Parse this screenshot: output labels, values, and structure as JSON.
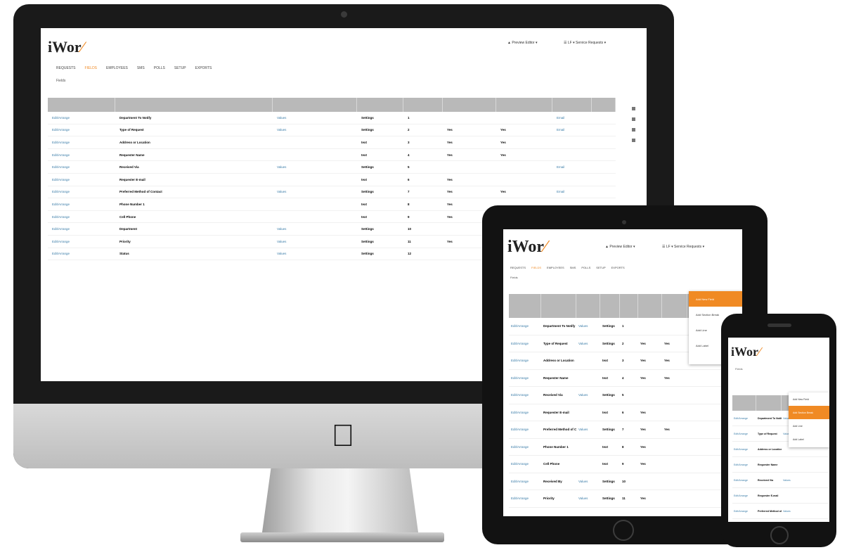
{
  "app": {
    "logo": "iWor",
    "user_label": "▲ Preview Editor ▾",
    "service_label": "☰ LF ▾  Service Requests ▾"
  },
  "tabs": [
    {
      "label": "REQUESTS"
    },
    {
      "label": "FIELDS",
      "active": true
    },
    {
      "label": "EMPLOYEES"
    },
    {
      "label": "SMS"
    },
    {
      "label": "POLLS"
    },
    {
      "label": "SETUP"
    },
    {
      "label": "EXPORTS"
    }
  ],
  "breadcrumb": "Fields",
  "imac_table": {
    "rows": [
      {
        "action": "Edit/Arrange",
        "name": "Department To Notify",
        "opt": "Values",
        "type": "Settings",
        "order": "1",
        "req": "",
        "shown": "",
        "flag": "Email"
      },
      {
        "action": "Edit/Arrange",
        "name": "Type of Request",
        "opt": "Values",
        "type": "Settings",
        "order": "2",
        "req": "Yes",
        "shown": "Yes",
        "flag": "Email"
      },
      {
        "action": "Edit/Arrange",
        "name": "Address or Location",
        "opt": "",
        "type": "text",
        "order": "3",
        "req": "Yes",
        "shown": "Yes",
        "flag": ""
      },
      {
        "action": "Edit/Arrange",
        "name": "Requester Name",
        "opt": "",
        "type": "text",
        "order": "4",
        "req": "Yes",
        "shown": "Yes",
        "flag": ""
      },
      {
        "action": "Edit/Arrange",
        "name": "Received Via",
        "opt": "Values",
        "type": "Settings",
        "order": "5",
        "req": "",
        "shown": "",
        "flag": "Email"
      },
      {
        "action": "Edit/Arrange",
        "name": "Requester E-mail",
        "opt": "",
        "type": "text",
        "order": "6",
        "req": "Yes",
        "shown": "",
        "flag": ""
      },
      {
        "action": "Edit/Arrange",
        "name": "Preferred Method of Contact",
        "opt": "Values",
        "type": "Settings",
        "order": "7",
        "req": "Yes",
        "shown": "Yes",
        "flag": "Email"
      },
      {
        "action": "Edit/Arrange",
        "name": "Phone Number 1",
        "opt": "",
        "type": "text",
        "order": "8",
        "req": "Yes",
        "shown": "",
        "flag": ""
      },
      {
        "action": "Edit/Arrange",
        "name": "Cell Phone",
        "opt": "",
        "type": "text",
        "order": "9",
        "req": "Yes",
        "shown": "",
        "flag": ""
      },
      {
        "action": "Edit/Arrange",
        "name": "Department",
        "opt": "Values",
        "type": "Settings",
        "order": "10",
        "req": "",
        "shown": "",
        "flag": ""
      },
      {
        "action": "Edit/Arrange",
        "name": "Priority",
        "opt": "Values",
        "type": "Settings",
        "order": "11",
        "req": "Yes",
        "shown": "",
        "flag": ""
      },
      {
        "action": "Edit/Arrange",
        "name": "Status",
        "opt": "Values",
        "type": "Settings",
        "order": "12",
        "req": "",
        "shown": "",
        "flag": ""
      }
    ]
  },
  "ipad_table": {
    "rows": [
      {
        "action": "Edit/Arrange",
        "name": "Department To Notify",
        "opt": "Values",
        "type": "Settings",
        "order": "1",
        "req": "",
        "shown": ""
      },
      {
        "action": "Edit/Arrange",
        "name": "Type of Request",
        "opt": "Values",
        "type": "Settings",
        "order": "2",
        "req": "Yes",
        "shown": "Yes"
      },
      {
        "action": "Edit/Arrange",
        "name": "Address or Location",
        "opt": "",
        "type": "text",
        "order": "3",
        "req": "Yes",
        "shown": "Yes"
      },
      {
        "action": "Edit/Arrange",
        "name": "Requester Name",
        "opt": "",
        "type": "text",
        "order": "4",
        "req": "Yes",
        "shown": "Yes"
      },
      {
        "action": "Edit/Arrange",
        "name": "Received Via",
        "opt": "Values",
        "type": "Settings",
        "order": "5",
        "req": "",
        "shown": ""
      },
      {
        "action": "Edit/Arrange",
        "name": "Requester E-mail",
        "opt": "",
        "type": "text",
        "order": "6",
        "req": "Yes",
        "shown": ""
      },
      {
        "action": "Edit/Arrange",
        "name": "Preferred Method of Contact",
        "opt": "Values",
        "type": "Settings",
        "order": "7",
        "req": "Yes",
        "shown": "Yes"
      },
      {
        "action": "Edit/Arrange",
        "name": "Phone Number 1",
        "opt": "",
        "type": "text",
        "order": "8",
        "req": "Yes",
        "shown": ""
      },
      {
        "action": "Edit/Arrange",
        "name": "Cell Phone",
        "opt": "",
        "type": "text",
        "order": "9",
        "req": "Yes",
        "shown": ""
      },
      {
        "action": "Edit/Arrange",
        "name": "Received By",
        "opt": "Values",
        "type": "Settings",
        "order": "10",
        "req": "",
        "shown": ""
      },
      {
        "action": "Edit/Arrange",
        "name": "Priority",
        "opt": "Values",
        "type": "Settings",
        "order": "11",
        "req": "Yes",
        "shown": ""
      }
    ]
  },
  "ipad_menu": [
    "Add New Field",
    "Add Section Break",
    "Add Line",
    "Add Label"
  ],
  "iphone_table": {
    "rows": [
      {
        "action": "Edit/Arrange",
        "name": "Department To Notify",
        "opt": "Values"
      },
      {
        "action": "Edit/Arrange",
        "name": "Type of Request",
        "opt": "Values"
      },
      {
        "action": "Edit/Arrange",
        "name": "Address or Location",
        "opt": ""
      },
      {
        "action": "Edit/Arrange",
        "name": "Requester Name",
        "opt": ""
      },
      {
        "action": "Edit/Arrange",
        "name": "Received Via",
        "opt": "Values"
      },
      {
        "action": "Edit/Arrange",
        "name": "Requester E-mail",
        "opt": ""
      },
      {
        "action": "Edit/Arrange",
        "name": "Preferred Method of Contact",
        "opt": "Values"
      }
    ]
  },
  "iphone_menu": [
    "Add New Field",
    "Add Section Break",
    "Add Line",
    "Add Label"
  ],
  "colors": {
    "accent": "#f08a24",
    "link": "#3a7ca8",
    "header": "#b9b9b9"
  }
}
